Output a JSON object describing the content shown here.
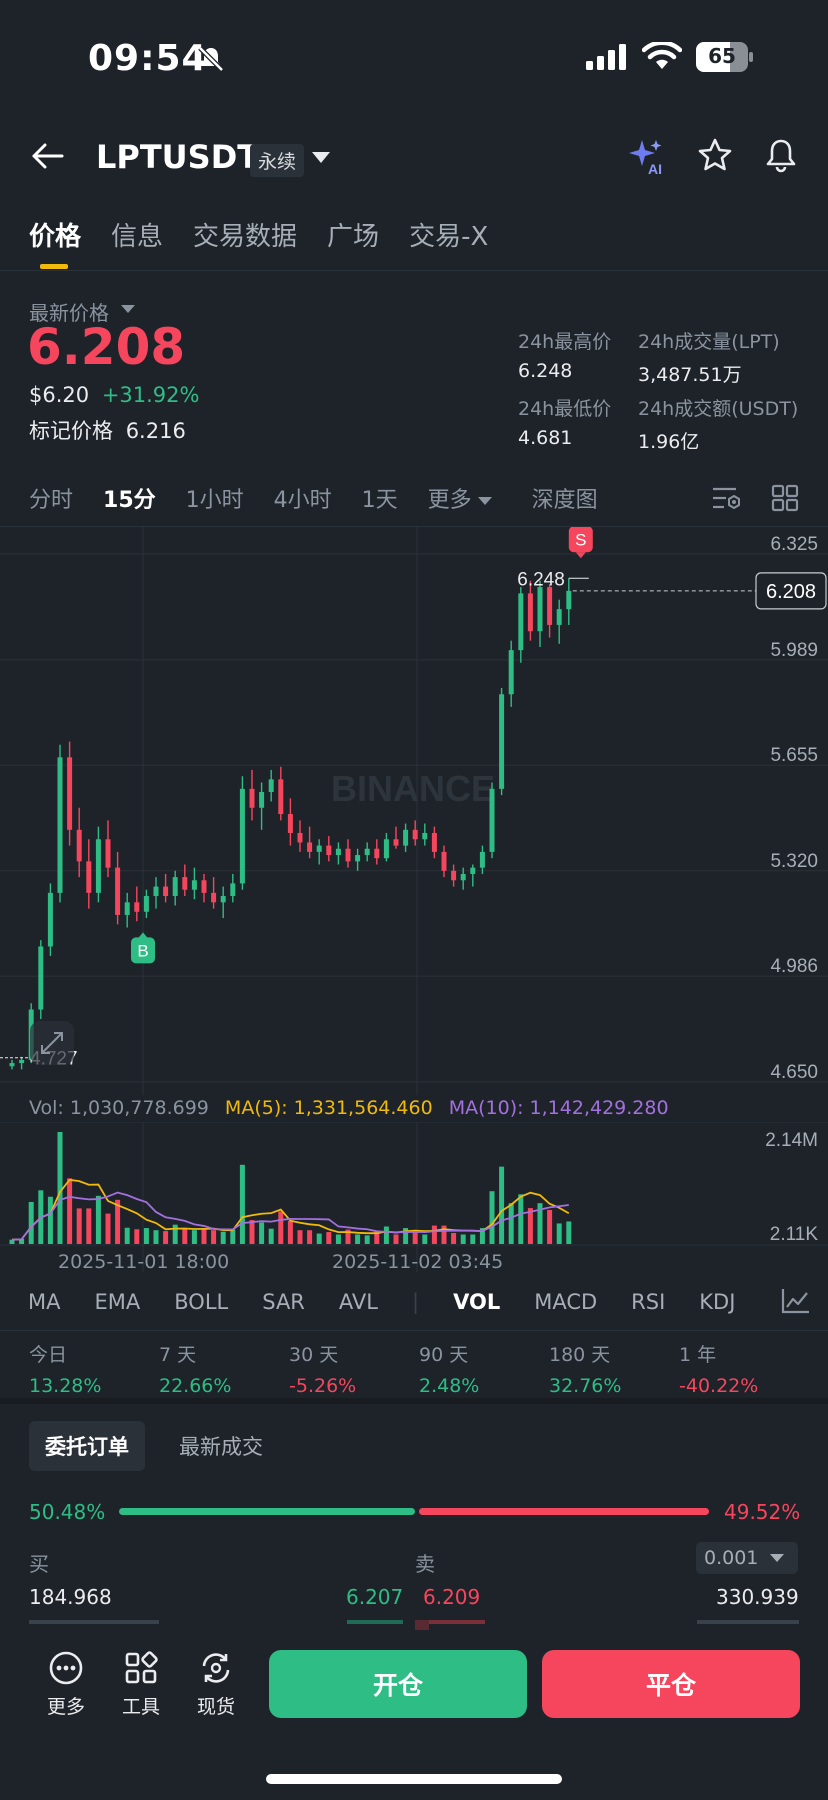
{
  "status_bar": {
    "time": "09:54",
    "battery": "65"
  },
  "header": {
    "symbol": "LPTUSDT",
    "contract_type": "永续"
  },
  "tabs": [
    {
      "label": "价格",
      "active": true
    },
    {
      "label": "信息",
      "active": false
    },
    {
      "label": "交易数据",
      "active": false
    },
    {
      "label": "广场",
      "active": false
    },
    {
      "label": "交易-X",
      "active": false
    }
  ],
  "price": {
    "latest_label": "最新价格",
    "last": "6.208",
    "usd": "$6.20",
    "change": "+31.92%",
    "mark_label": "标记价格",
    "mark_value": "6.216"
  },
  "stats": {
    "high_label": "24h最高价",
    "high": "6.248",
    "low_label": "24h最低价",
    "low": "4.681",
    "vol_lpt_label": "24h成交量(LPT)",
    "vol_lpt": "3,487.51万",
    "vol_usdt_label": "24h成交额(USDT)",
    "vol_usdt": "1.96亿"
  },
  "timeframes": [
    "分时",
    "15分",
    "1小时",
    "4小时",
    "1天",
    "更多",
    "深度图"
  ],
  "timeframe_active": "15分",
  "chart_data": {
    "type": "candlestick",
    "interval": "15分",
    "y_ticks": [
      "6.325",
      "5.989",
      "5.655",
      "5.320",
      "4.986",
      "4.650"
    ],
    "ylim": [
      4.65,
      6.325
    ],
    "last_price_label": "6.208",
    "max_label": "6.248",
    "min_label": "4.727",
    "buy_marker": "B",
    "sell_marker": "S",
    "watermark": "BINANCE",
    "x_ticks": [
      "2025-11-01 18:00",
      "2025-11-02 03:45"
    ],
    "candles": [
      [
        4.7,
        4.72,
        4.69,
        4.71
      ],
      [
        4.71,
        4.73,
        4.69,
        4.72
      ],
      [
        4.72,
        4.9,
        4.71,
        4.88
      ],
      [
        4.88,
        5.1,
        4.85,
        5.08
      ],
      [
        5.08,
        5.28,
        5.05,
        5.25
      ],
      [
        5.25,
        5.72,
        5.22,
        5.68
      ],
      [
        5.68,
        5.73,
        5.4,
        5.45
      ],
      [
        5.45,
        5.52,
        5.3,
        5.35
      ],
      [
        5.35,
        5.42,
        5.2,
        5.25
      ],
      [
        5.25,
        5.46,
        5.22,
        5.42
      ],
      [
        5.42,
        5.48,
        5.3,
        5.33
      ],
      [
        5.33,
        5.38,
        5.15,
        5.18
      ],
      [
        5.18,
        5.25,
        5.14,
        5.22
      ],
      [
        5.22,
        5.27,
        5.16,
        5.19
      ],
      [
        5.19,
        5.26,
        5.17,
        5.24
      ],
      [
        5.24,
        5.3,
        5.2,
        5.27
      ],
      [
        5.27,
        5.31,
        5.22,
        5.24
      ],
      [
        5.24,
        5.32,
        5.21,
        5.3
      ],
      [
        5.3,
        5.34,
        5.24,
        5.26
      ],
      [
        5.26,
        5.33,
        5.23,
        5.29
      ],
      [
        5.29,
        5.31,
        5.22,
        5.25
      ],
      [
        5.25,
        5.3,
        5.2,
        5.22
      ],
      [
        5.22,
        5.27,
        5.17,
        5.24
      ],
      [
        5.24,
        5.31,
        5.22,
        5.28
      ],
      [
        5.28,
        5.62,
        5.26,
        5.58
      ],
      [
        5.58,
        5.64,
        5.48,
        5.52
      ],
      [
        5.52,
        5.6,
        5.45,
        5.57
      ],
      [
        5.57,
        5.64,
        5.54,
        5.61
      ],
      [
        5.61,
        5.65,
        5.48,
        5.5
      ],
      [
        5.5,
        5.55,
        5.4,
        5.44
      ],
      [
        5.44,
        5.48,
        5.38,
        5.41
      ],
      [
        5.41,
        5.46,
        5.36,
        5.38
      ],
      [
        5.38,
        5.42,
        5.34,
        5.4
      ],
      [
        5.4,
        5.43,
        5.35,
        5.37
      ],
      [
        5.37,
        5.41,
        5.34,
        5.39
      ],
      [
        5.39,
        5.42,
        5.33,
        5.35
      ],
      [
        5.35,
        5.39,
        5.32,
        5.37
      ],
      [
        5.37,
        5.41,
        5.35,
        5.39
      ],
      [
        5.39,
        5.42,
        5.34,
        5.36
      ],
      [
        5.36,
        5.44,
        5.35,
        5.42
      ],
      [
        5.42,
        5.46,
        5.39,
        5.4
      ],
      [
        5.4,
        5.47,
        5.38,
        5.45
      ],
      [
        5.45,
        5.48,
        5.4,
        5.42
      ],
      [
        5.42,
        5.47,
        5.4,
        5.44
      ],
      [
        5.44,
        5.46,
        5.36,
        5.38
      ],
      [
        5.38,
        5.4,
        5.3,
        5.32
      ],
      [
        5.32,
        5.34,
        5.27,
        5.29
      ],
      [
        5.29,
        5.33,
        5.26,
        5.31
      ],
      [
        5.31,
        5.34,
        5.27,
        5.33
      ],
      [
        5.33,
        5.4,
        5.31,
        5.38
      ],
      [
        5.38,
        5.6,
        5.36,
        5.58
      ],
      [
        5.58,
        5.9,
        5.56,
        5.88
      ],
      [
        5.88,
        6.05,
        5.84,
        6.02
      ],
      [
        6.02,
        6.22,
        5.98,
        6.2
      ],
      [
        6.2,
        6.24,
        6.05,
        6.08
      ],
      [
        6.08,
        6.24,
        6.03,
        6.22
      ],
      [
        6.22,
        6.23,
        6.06,
        6.1
      ],
      [
        6.1,
        6.18,
        6.04,
        6.15
      ],
      [
        6.15,
        6.248,
        6.1,
        6.208
      ]
    ]
  },
  "volume": {
    "label": "Vol: 1,030,778.699",
    "ma5_label": "MA(5): 1,331,564.460",
    "ma10_label": "MA(10): 1,142,429.280",
    "max_tick": "2.14M",
    "min_tick": "2.11K",
    "colors": {
      "ma5": "#f0b90b",
      "ma10": "#a370e0"
    }
  },
  "indicators": [
    "MA",
    "EMA",
    "BOLL",
    "SAR",
    "AVL",
    "VOL",
    "MACD",
    "RSI",
    "KDJ",
    "O"
  ],
  "indicator_active": "VOL",
  "performance": [
    {
      "period": "今日",
      "value": "13.28%",
      "dir": "up"
    },
    {
      "period": "7 天",
      "value": "22.66%",
      "dir": "up"
    },
    {
      "period": "30 天",
      "value": "-5.26%",
      "dir": "down"
    },
    {
      "period": "90 天",
      "value": "2.48%",
      "dir": "up"
    },
    {
      "period": "180 天",
      "value": "32.76%",
      "dir": "up"
    },
    {
      "period": "1 年",
      "value": "-40.22%",
      "dir": "down"
    }
  ],
  "orderbook": {
    "tab_active": "委托订单",
    "tab_other": "最新成交",
    "buy_ratio": "50.48%",
    "sell_ratio": "49.52%",
    "buy_label": "买",
    "sell_label": "卖",
    "precision": "0.001",
    "row": {
      "bid_qty": "184.968",
      "bid_price": "6.207",
      "ask_price": "6.209",
      "ask_qty": "330.939"
    }
  },
  "bottom": {
    "more": "更多",
    "tools": "工具",
    "spot": "现货",
    "open": "开仓",
    "close": "平仓"
  },
  "colors": {
    "up": "#2ebd85",
    "down": "#f6465d",
    "accent": "#f0b90b",
    "bg": "#1e2329"
  }
}
